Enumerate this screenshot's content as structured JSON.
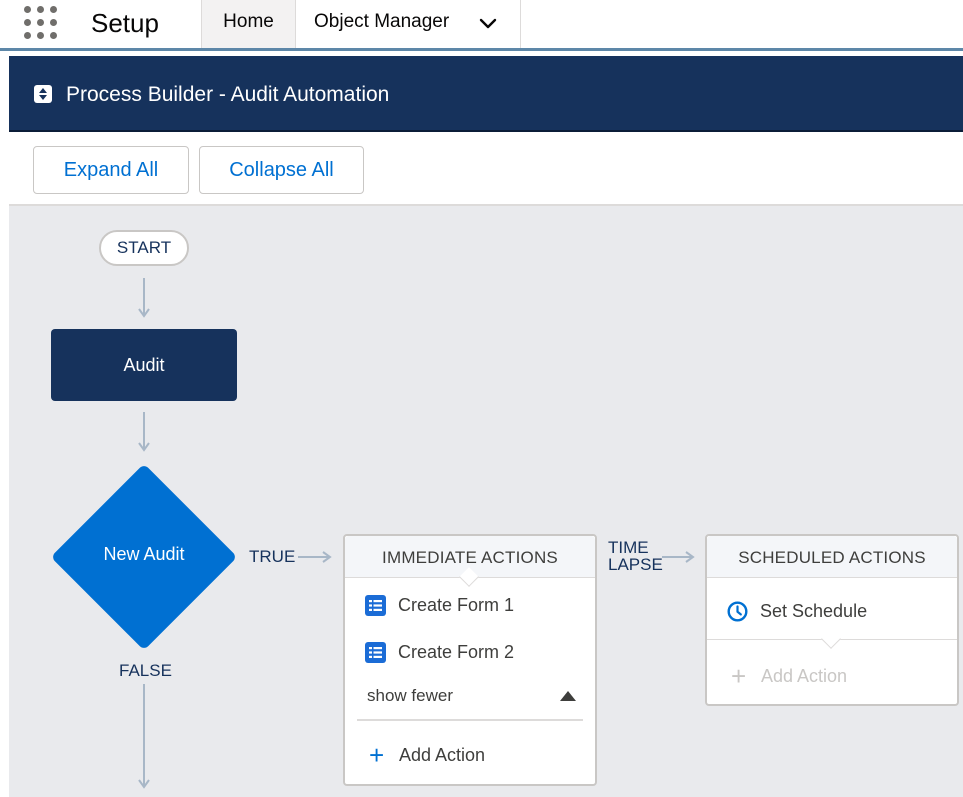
{
  "topnav": {
    "app_name": "Setup",
    "tabs": [
      {
        "label": "Home",
        "active": true
      },
      {
        "label": "Object Manager",
        "has_dropdown": true
      }
    ]
  },
  "header": {
    "title": "Process Builder - Audit Automation",
    "icon": "process-builder-icon"
  },
  "toolbar": {
    "expand_label": "Expand All",
    "collapse_label": "Collapse All"
  },
  "canvas": {
    "start_label": "START",
    "criteria_node": {
      "label": "Audit"
    },
    "decision": {
      "label": "New Audit",
      "true_label": "TRUE",
      "false_label": "FALSE"
    },
    "immediate_actions": {
      "title": "IMMEDIATE ACTIONS",
      "items": [
        {
          "label": "Create Form 1",
          "icon": "record-create-icon"
        },
        {
          "label": "Create Form 2",
          "icon": "record-create-icon"
        }
      ],
      "toggle_label": "show fewer",
      "add_action_label": "Add Action"
    },
    "time_lapse": {
      "line1": "TIME",
      "line2": "LAPSE"
    },
    "scheduled_actions": {
      "title": "SCHEDULED ACTIONS",
      "items": [
        {
          "label": "Set Schedule",
          "icon": "clock-icon"
        }
      ],
      "add_action_label": "Add Action",
      "add_action_enabled": false
    }
  },
  "colors": {
    "navy": "#16325c",
    "brand_blue": "#0070d2",
    "canvas_bg": "#e9eaed",
    "nav_rule": "#5d87a8"
  }
}
